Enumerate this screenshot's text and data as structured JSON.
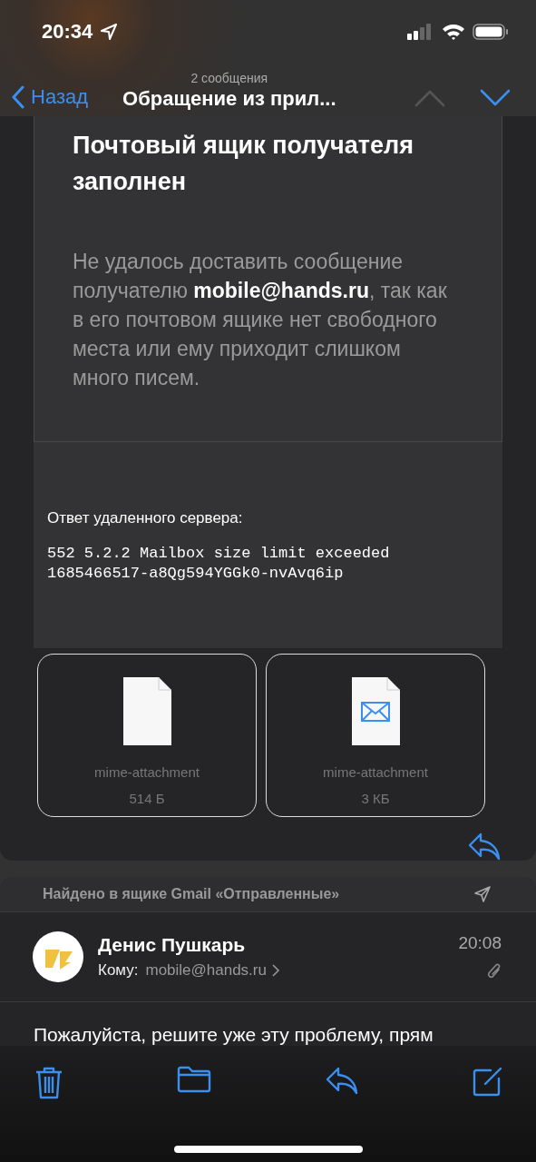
{
  "status_bar": {
    "time": "20:34"
  },
  "nav": {
    "back": "Назад",
    "subtitle": "2 сообщения",
    "title": "Обращение из прил...",
    "prev_disabled": true,
    "next_disabled": false
  },
  "message": {
    "notice_title": "Почтовый ящик получателя заполнен",
    "notice_text": "Не удалось доставить сообщение получателю **mobile@hands.ru**, так как в его почтовом ящике нет свободного места или ему приходит слишком много писем.",
    "server_label": "Ответ удаленного сервера:",
    "server_lines": [
      "552 5.2.2 Mailbox size limit exceeded",
      "1685466517-a8Qg594YGGk0-nvAvq6ip"
    ],
    "attachments": [
      {
        "kind": "file",
        "name": "mime-attachment",
        "size": "514 Б"
      },
      {
        "kind": "email",
        "name": "mime-attachment",
        "size": "3 КБ"
      }
    ]
  },
  "found_message": {
    "folder_note": "Найдено в ящике Gmail «Отправленные»",
    "sender": "Денис Пушкарь",
    "to_label": "Кому:",
    "to": "mobile@hands.ru",
    "time": "20:08",
    "has_attachment": true,
    "body": "Пожалуйста, решите уже эту проблему, прям"
  }
}
